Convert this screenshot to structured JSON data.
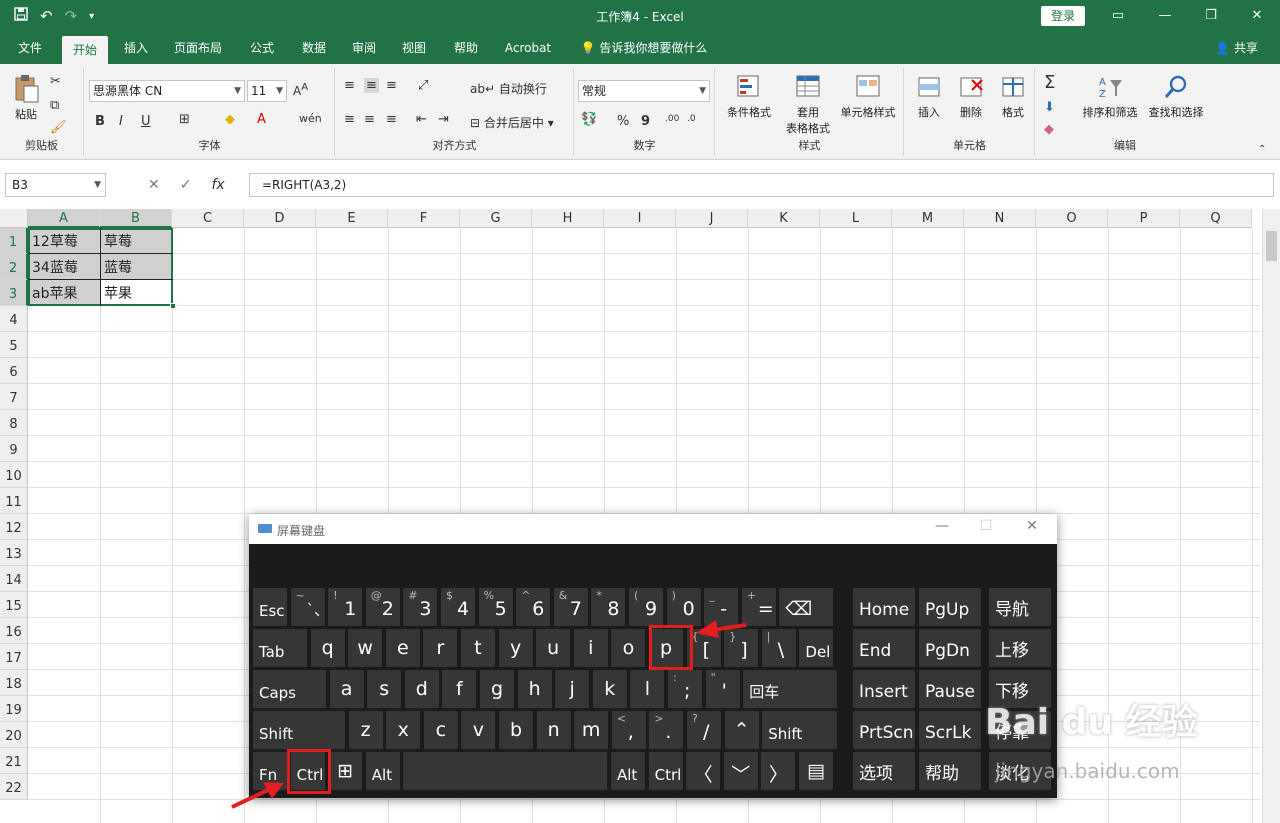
{
  "window": {
    "title": "工作簿4  -  Excel",
    "login": "登录",
    "qat": [
      "save-icon",
      "undo-icon",
      "redo-icon",
      "customize-icon"
    ]
  },
  "tabs": [
    "文件",
    "开始",
    "插入",
    "页面布局",
    "公式",
    "数据",
    "审阅",
    "视图",
    "帮助",
    "Acrobat",
    "告诉我你想要做什么"
  ],
  "active_tab": "开始",
  "share": "共享",
  "ribbon": {
    "clipboard": {
      "paste": "粘贴",
      "label": "剪贴板"
    },
    "font": {
      "name": "思源黑体 CN",
      "size": "11",
      "bold": "B",
      "italic": "I",
      "underline": "U",
      "label": "字体"
    },
    "alignment": {
      "wrap": "自动换行",
      "merge": "合并后居中",
      "label": "对齐方式"
    },
    "number": {
      "format": "常规",
      "percent": "%",
      "comma": "9",
      "label": "数字"
    },
    "styles": {
      "cond": "条件格式",
      "table_line1": "套用",
      "table_line2": "表格格式",
      "cell_style": "单元格样式",
      "label": "样式"
    },
    "cells": {
      "insert": "插入",
      "delete": "删除",
      "format": "格式",
      "label": "单元格"
    },
    "editing": {
      "sort": "排序和筛选",
      "find": "查找和选择",
      "label": "编辑"
    }
  },
  "formula_bar": {
    "name_box": "B3",
    "formula": "=RIGHT(A3,2)",
    "cancel": "✕",
    "enter": "✓",
    "fx": "fx"
  },
  "columns": [
    "A",
    "B",
    "C",
    "D",
    "E",
    "F",
    "G",
    "H",
    "I",
    "J",
    "K",
    "L",
    "M",
    "N",
    "O",
    "P",
    "Q"
  ],
  "rows": [
    "1",
    "2",
    "3",
    "4",
    "5",
    "6",
    "7",
    "8",
    "9",
    "10",
    "11",
    "12",
    "13",
    "14",
    "15",
    "16",
    "17",
    "18",
    "19",
    "20",
    "21",
    "22"
  ],
  "cells": {
    "A1": "12草莓",
    "B1": "草莓",
    "A2": "34蓝莓",
    "B2": "蓝莓",
    "A3": "ab苹果",
    "B3": "苹果"
  },
  "osk": {
    "title": "屏幕键盘",
    "row1": [
      {
        "m": "Esc"
      },
      {
        "s": "~",
        "m": "`、"
      },
      {
        "s": "!",
        "m": "1"
      },
      {
        "s": "@",
        "m": "2"
      },
      {
        "s": "#",
        "m": "3"
      },
      {
        "s": "$",
        "m": "4"
      },
      {
        "s": "%",
        "m": "5"
      },
      {
        "s": "^",
        "m": "6"
      },
      {
        "s": "&",
        "m": "7"
      },
      {
        "s": "*",
        "m": "8"
      },
      {
        "s": "(",
        "m": "9"
      },
      {
        "s": ")",
        "m": "0"
      },
      {
        "s": "_",
        "m": "-"
      },
      {
        "s": "+",
        "m": "="
      },
      {
        "m": "⌫"
      }
    ],
    "row2": [
      {
        "m": "Tab"
      },
      {
        "m": "q"
      },
      {
        "m": "w"
      },
      {
        "m": "e"
      },
      {
        "m": "r"
      },
      {
        "m": "t"
      },
      {
        "m": "y"
      },
      {
        "m": "u"
      },
      {
        "m": "i"
      },
      {
        "m": "o"
      },
      {
        "m": "p"
      },
      {
        "s": "{",
        "m": "["
      },
      {
        "s": "}",
        "m": "]"
      },
      {
        "s": "|",
        "m": "\\"
      },
      {
        "m": "Del"
      }
    ],
    "row3": [
      {
        "m": "Caps"
      },
      {
        "m": "a"
      },
      {
        "m": "s"
      },
      {
        "m": "d"
      },
      {
        "m": "f"
      },
      {
        "m": "g"
      },
      {
        "m": "h"
      },
      {
        "m": "j"
      },
      {
        "m": "k"
      },
      {
        "m": "l"
      },
      {
        "s": ":",
        "m": ";"
      },
      {
        "s": "\"",
        "m": "'"
      },
      {
        "m": "回车"
      }
    ],
    "row4": [
      {
        "m": "Shift"
      },
      {
        "m": "z"
      },
      {
        "m": "x"
      },
      {
        "m": "c"
      },
      {
        "m": "v"
      },
      {
        "m": "b"
      },
      {
        "m": "n"
      },
      {
        "m": "m"
      },
      {
        "s": "<",
        "m": ","
      },
      {
        "s": ">",
        "m": "."
      },
      {
        "s": "?",
        "m": "/"
      },
      {
        "m": "⌃"
      },
      {
        "m": "Shift"
      }
    ],
    "row5": [
      {
        "m": "Fn"
      },
      {
        "m": "Ctrl"
      },
      {
        "m": "⊞"
      },
      {
        "m": "Alt"
      },
      {
        "m": ""
      },
      {
        "m": "Alt"
      },
      {
        "m": "Ctrl"
      },
      {
        "m": "〈"
      },
      {
        "m": "﹀"
      },
      {
        "m": "〉"
      },
      {
        "m": "▤"
      }
    ],
    "nav": [
      [
        "Home",
        "PgUp",
        "导航"
      ],
      [
        "End",
        "PgDn",
        "上移"
      ],
      [
        "Insert",
        "Pause",
        "下移"
      ],
      [
        "PrtScn",
        "ScrLk",
        "停靠"
      ],
      [
        "选项",
        "帮助",
        "淡化"
      ]
    ]
  },
  "watermark": {
    "brand": "Bai du 经验",
    "url": "jingyan.baidu.com"
  },
  "colors": {
    "excel_green": "#217346",
    "highlight_red": "#e41e1e"
  }
}
